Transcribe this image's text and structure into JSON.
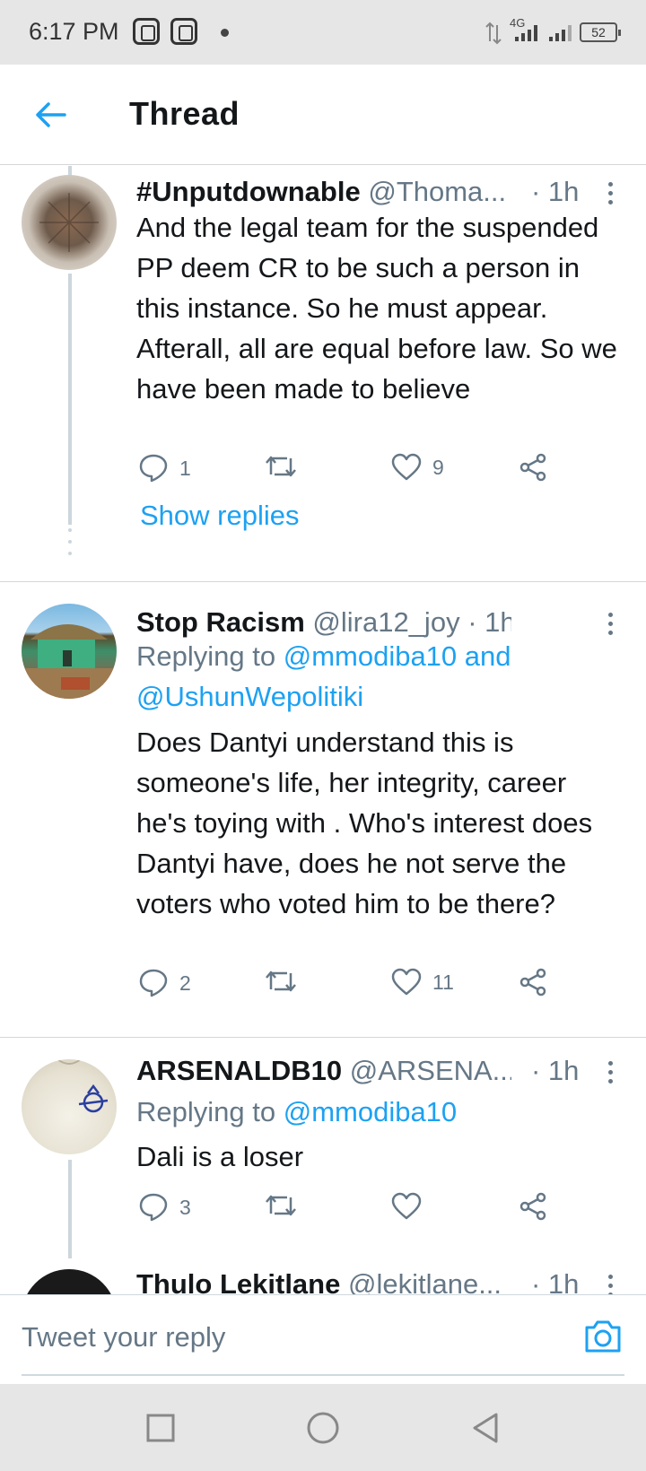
{
  "status_bar": {
    "time": "6:17 PM",
    "network": "4G",
    "battery": "52"
  },
  "header": {
    "title": "Thread"
  },
  "tweets": [
    {
      "name": "#Unputdownable",
      "handle": "@Thoma...",
      "time": "· 1h",
      "reply_to_prefix": "",
      "text": "And the legal team for the suspended PP deem CR to be such a person in this instance. So he must appear. Afterall, all are equal before law. So we have been made to believe",
      "replies": "1",
      "retweets": "",
      "likes": "9",
      "show_replies": "Show replies"
    },
    {
      "name": "Stop Racism",
      "handle": "@lira12_joy",
      "time": "· 1h",
      "reply_to_prefix": "Replying to",
      "reply_to_mentions": "@mmodiba10 and @UshunWepolitiki",
      "text": "Does Dantyi understand this is someone's life, her integrity, career he's toying with . Who's interest does Dantyi have, does he not serve the voters who voted him to be there?",
      "replies": "2",
      "retweets": "",
      "likes": "11"
    },
    {
      "name": "ARSENALDB10",
      "handle": "@ARSENA...",
      "time": "· 1h",
      "reply_to_prefix": "Replying to",
      "reply_to_mentions": "@mmodiba10",
      "text": "Dali is a loser",
      "replies": "3",
      "retweets": "",
      "likes": ""
    },
    {
      "name": "Thulo Lekitlane",
      "handle": "@lekitlane...",
      "time": "· 1h"
    }
  ],
  "reply_bar": {
    "placeholder": "Tweet your reply"
  },
  "icons": {
    "back": "arrow-left-icon",
    "reply": "speech-bubble-icon",
    "retweet": "retweet-icon",
    "like": "heart-icon",
    "share": "share-icon",
    "more": "more-vertical-icon",
    "camera": "camera-icon"
  },
  "colors": {
    "accent": "#1da1f2",
    "secondary_text": "#657786",
    "divider": "#d6d6d6",
    "system_bar": "#e6e6e6"
  }
}
